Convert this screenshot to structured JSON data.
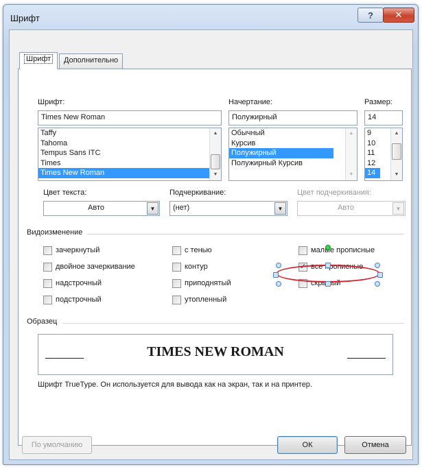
{
  "window": {
    "title": "Шрифт"
  },
  "titlebar": {
    "help": "?",
    "close": "✕"
  },
  "tabs": [
    {
      "label": "Шрифт",
      "active": true
    },
    {
      "label": "Дополнительно",
      "active": false
    }
  ],
  "font": {
    "label": "Шрифт:",
    "value": "Times New Roman",
    "items": [
      "Taffy",
      "Tahoma",
      "Tempus Sans ITC",
      "Times",
      "Times New Roman"
    ],
    "selected_index": 4
  },
  "style": {
    "label": "Начертание:",
    "value": "Полужирный",
    "items": [
      "Обычный",
      "Курсив",
      "Полужирный",
      "Полужирный Курсив"
    ],
    "selected_index": 2
  },
  "size": {
    "label": "Размер:",
    "value": "14",
    "items": [
      "9",
      "10",
      "11",
      "12",
      "14"
    ],
    "selected_index": 4
  },
  "text_color": {
    "label": "Цвет текста:",
    "value": "Авто"
  },
  "underline": {
    "label": "Подчеркивание:",
    "value": "(нет)"
  },
  "underline_color": {
    "label": "Цвет подчеркивания:",
    "value": "Авто"
  },
  "effects": {
    "label": "Видоизменение",
    "strikethrough": {
      "label": "зачеркнутый",
      "checked": false
    },
    "double_strikethrough": {
      "label": "двойное зачеркивание",
      "checked": false
    },
    "superscript": {
      "label": "надстрочный",
      "checked": false
    },
    "subscript": {
      "label": "подстрочный",
      "checked": false
    },
    "shadow": {
      "label": "с тенью",
      "checked": false
    },
    "outline": {
      "label": "контур",
      "checked": false
    },
    "emboss": {
      "label": "приподнятый",
      "checked": false
    },
    "engrave": {
      "label": "утопленный",
      "checked": false
    },
    "small_caps": {
      "label": "малые прописные",
      "checked": false
    },
    "all_caps": {
      "label": "все прописные",
      "checked": true
    },
    "hidden": {
      "label": "скрытый",
      "checked": false
    }
  },
  "preview": {
    "label": "Образец",
    "text": "TIMES NEW ROMAN",
    "note": "Шрифт TrueType. Он используется для вывода как на экран, так и на принтер."
  },
  "buttons": {
    "default": "По умолчанию",
    "ok": "ОК",
    "cancel": "Отмена"
  },
  "colors": {
    "selection": "#3399ff",
    "highlight_ellipse": "#d61f2c",
    "rotate_handle": "#39d44a"
  },
  "icons": {
    "scroll_up": "triangle-up",
    "scroll_down": "triangle-down",
    "dropdown": "triangle-down",
    "check": "checkmark"
  }
}
